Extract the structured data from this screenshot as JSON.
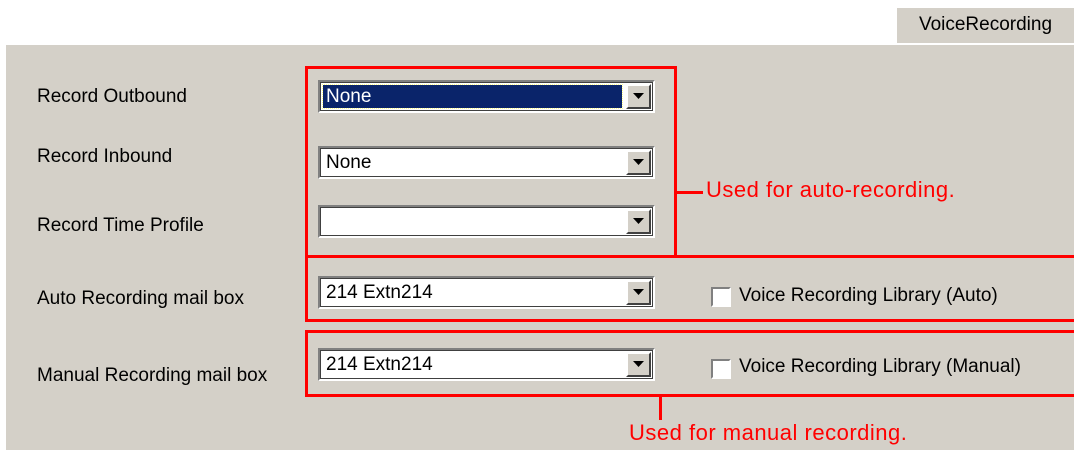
{
  "tab": {
    "label": "VoiceRecording"
  },
  "fields": [
    {
      "label": "Record Outbound",
      "value": "None",
      "selected": true
    },
    {
      "label": "Record Inbound",
      "value": "None",
      "selected": false
    },
    {
      "label": "Record Time Profile",
      "value": "",
      "selected": false
    },
    {
      "label": "Auto Recording mail box",
      "value": "214  Extn214",
      "selected": false
    },
    {
      "label": "Manual Recording mail box",
      "value": "214  Extn214",
      "selected": false
    }
  ],
  "checkboxes": [
    {
      "label": "Voice Recording Library (Auto)",
      "checked": false
    },
    {
      "label": "Voice Recording Library (Manual)",
      "checked": false
    }
  ],
  "annotations": {
    "auto": "Used for auto-recording.",
    "manual": "Used for manual recording."
  },
  "colors": {
    "dialog_bg": "#d4d0c8",
    "selection": "#0a246a",
    "annotation": "#ff0000"
  },
  "icons": {
    "dropdown": "chevron-down-icon"
  }
}
